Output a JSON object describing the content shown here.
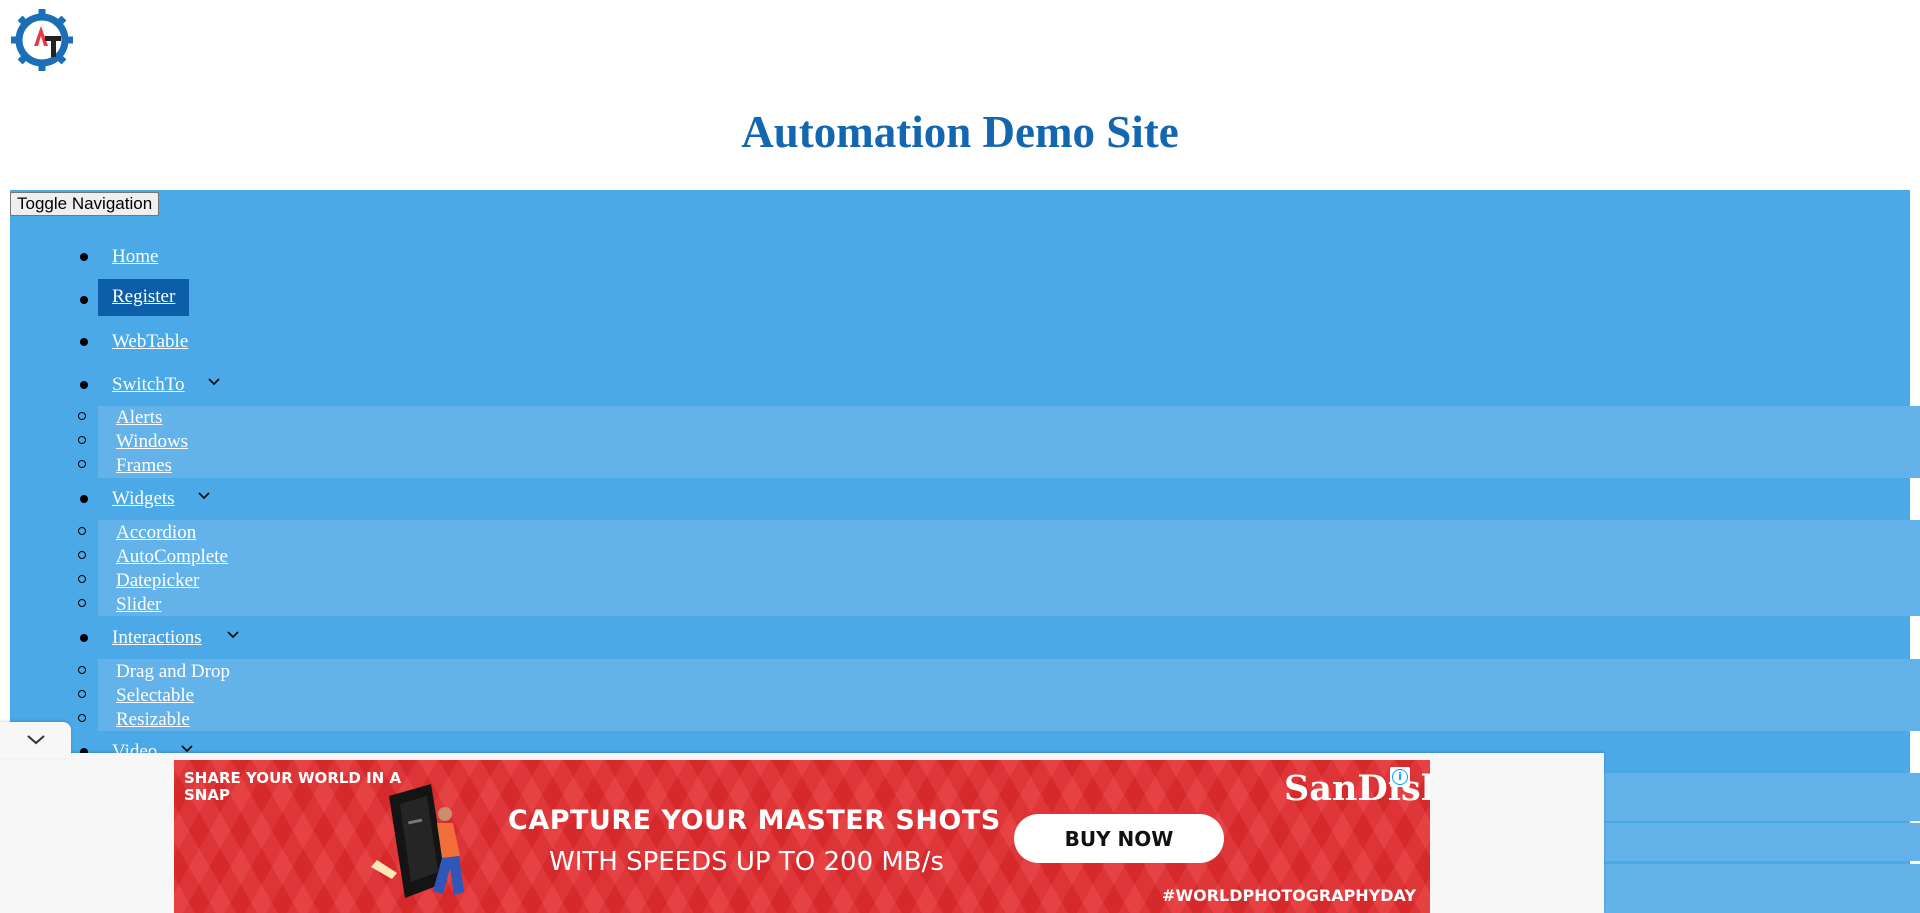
{
  "site": {
    "title": "Automation Demo Site",
    "logo_icon": "automation-testing-gear-logo",
    "toggle_label": "Toggle Navigation"
  },
  "nav": {
    "items": [
      {
        "label": "Home"
      },
      {
        "label": "Register",
        "active": true
      },
      {
        "label": "WebTable"
      },
      {
        "label": "SwitchTo",
        "icon": "chevron-down-icon",
        "children": [
          {
            "label": "Alerts"
          },
          {
            "label": "Windows"
          },
          {
            "label": "Frames"
          }
        ]
      },
      {
        "label": "Widgets",
        "icon": "chevron-down-icon",
        "children": [
          {
            "label": "Accordion"
          },
          {
            "label": "AutoComplete"
          },
          {
            "label": "Datepicker"
          },
          {
            "label": "Slider"
          }
        ]
      },
      {
        "label": "Interactions",
        "icon": "chevron-down-icon",
        "children": [
          {
            "label": "Drag and Drop"
          },
          {
            "label": "Selectable"
          },
          {
            "label": "Resizable"
          }
        ]
      },
      {
        "label": "Video",
        "icon": "chevron-down-icon"
      }
    ]
  },
  "ad": {
    "tagline": "SHARE YOUR WORLD IN A SNAP",
    "brand": "SanDisk",
    "headline_1": "CAPTURE YOUR MASTER SHOTS",
    "headline_2": "WITH SPEEDS UP TO 200 MB/s",
    "cta_label": "BUY NOW",
    "hashtag": "#WORLDPHOTOGRAPHYDAY",
    "info_icon": "info-icon",
    "collapse_icon": "chevron-down-icon"
  },
  "colors": {
    "title_blue": "#1367b0",
    "nav_bg": "#4ba9e8",
    "nav_submenu_bg": "#63b3ea",
    "nav_active_bg": "#0d5ea8",
    "ad_red": "#e32b2e"
  }
}
